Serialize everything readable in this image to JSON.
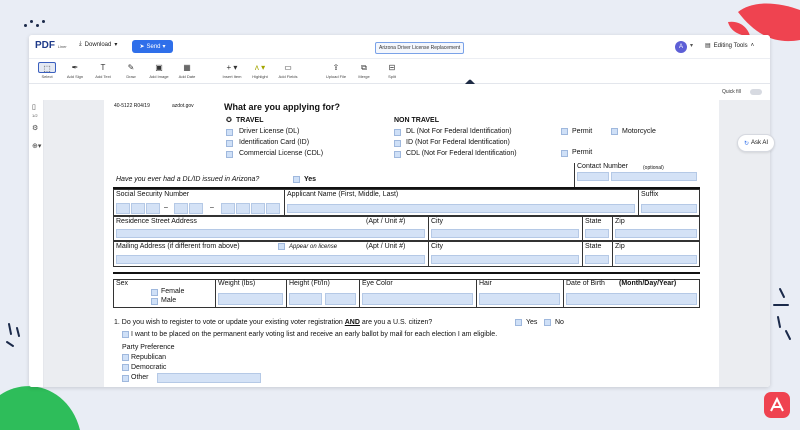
{
  "app": {
    "logo": "PDF",
    "logo_sub": "Liner",
    "download_label": "Download",
    "send_label": "Send",
    "document_title": "Arizona Driver License Replacement",
    "avatar_initial": "A",
    "editing_tools_label": "Editing Tools",
    "quick_fill_label": "Quick fill",
    "ask_ai_label": "Ask AI",
    "page_indicator": "1/2"
  },
  "toolbar": {
    "tools": [
      {
        "label": "Select",
        "icon": "cursor-icon"
      },
      {
        "label": "Add Sign",
        "icon": "signature-icon"
      },
      {
        "label": "Add Text",
        "icon": "text-icon"
      },
      {
        "label": "Draw",
        "icon": "pen-icon"
      },
      {
        "label": "Add Image",
        "icon": "image-icon"
      },
      {
        "label": "Add Date",
        "icon": "calendar-icon"
      },
      {
        "label": "Insert Item",
        "icon": "plus-icon"
      },
      {
        "label": "Highlight",
        "icon": "highlight-icon"
      },
      {
        "label": "Add Fields",
        "icon": "fields-icon"
      },
      {
        "label": "Upload File",
        "icon": "upload-icon"
      },
      {
        "label": "Merge",
        "icon": "merge-icon"
      },
      {
        "label": "Split",
        "icon": "split-icon"
      }
    ]
  },
  "form": {
    "form_id": "40-5122 R04/19",
    "site": "azdot.gov",
    "question": "What are you applying for?",
    "travel_heading": "TRAVEL",
    "non_travel_heading": "NON TRAVEL",
    "travel_options": [
      "Driver License (DL)",
      "Identification Card (ID)",
      "Commercial License (CDL)"
    ],
    "non_travel_options": [
      "DL (Not For Federal Identification)",
      "ID (Not For Federal Identification)",
      "CDL (Not For Federal Identification)"
    ],
    "permit_label": "Permit",
    "motorcycle_label": "Motorcycle",
    "contact_number_label": "Contact Number",
    "optional_label": "(optional)",
    "prior_dl_question": "Have you ever had a DL/ID issued in Arizona?",
    "yes_label": "Yes",
    "no_label": "No",
    "ssn_label": "Social Security Number",
    "applicant_name_label": "Applicant Name (First, Middle, Last)",
    "suffix_label": "Suffix",
    "residence_label": "Residence Street Address",
    "apt_label": "(Apt / Unit #)",
    "city_label": "City",
    "state_label": "State",
    "zip_label": "Zip",
    "mailing_label": "Mailing Address (if different from above)",
    "appear_on_license": "Appear on license",
    "sex_label": "Sex",
    "female_label": "Female",
    "male_label": "Male",
    "weight_label": "Weight (lbs)",
    "height_label": "Height (Ft/In)",
    "eye_color_label": "Eye Color",
    "hair_label": "Hair",
    "dob_label": "Date of Birth",
    "dob_format": "(Month/Day/Year)",
    "voter_question_pre": "1. Do you wish to register to vote or update your existing voter registration",
    "voter_question_and": "AND",
    "voter_question_post": "are you a U.S. citizen?",
    "early_voting": "I want to be placed on the permanent early voting list and receive an early ballot by mail for each election I am eligible.",
    "party_preference": "Party Preference",
    "parties": [
      "Republican",
      "Democratic",
      "Other"
    ]
  },
  "colors": {
    "send_button": "#2f6fea",
    "accent_red": "#ef4350",
    "accent_green": "#2ebd5a",
    "field_fill": "#d4e2f6"
  }
}
